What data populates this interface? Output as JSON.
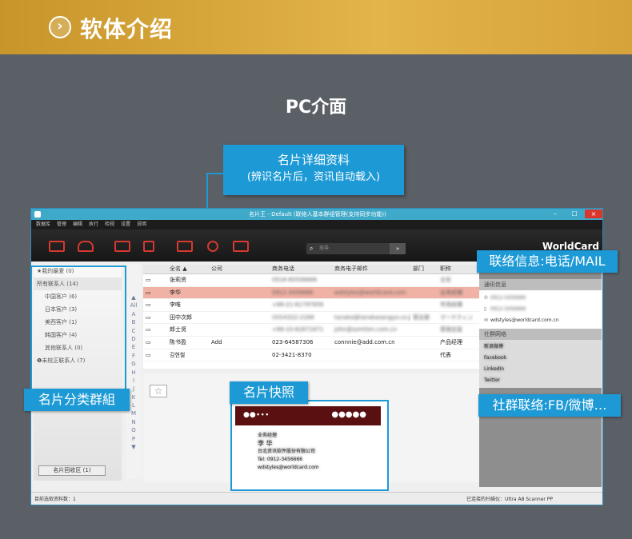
{
  "banner": {
    "icon": "chevron-right-icon",
    "title": "软体介绍"
  },
  "subtitle": "PC介面",
  "callouts": {
    "detail_line1": "名片详细资料",
    "detail_line2": "(辨识名片后，资讯自动载入)",
    "contact_info": "联络信息:电话/MAIL",
    "groups": "名片分类群組",
    "snapshot": "名片快照",
    "social": "社群联络:FB/微博…"
  },
  "window": {
    "title": "名片王 - Default (联络人基本群组管理(支持同步功能))",
    "menu": [
      "数据库",
      "管理",
      "编辑",
      "执行",
      "检视",
      "设置",
      "说明"
    ],
    "search_placeholder": "搜尋",
    "brand": "WorldCard",
    "controls": {
      "minimize": "–",
      "maximize": "☐",
      "close": "×"
    }
  },
  "sidebar": {
    "favorites": "★我的最爱 (0)",
    "all": "所有联系人 (14)",
    "groups": [
      "中国客户 (6)",
      "日本客户 (3)",
      "美西客户 (1)",
      "韩国客户 (4)",
      "其他联系人 (0)"
    ],
    "unconfirmed": "❶未校正联系人 (7)",
    "bin_button": "名片回收区 (1)"
  },
  "alpha_index": [
    "▲",
    "All",
    "A",
    "B",
    "C",
    "D",
    "E",
    "F",
    "G",
    "H",
    "I",
    "J",
    "K",
    "L",
    "M",
    "N",
    "O",
    "P",
    "▼"
  ],
  "grid": {
    "headers": [
      "",
      "全名 ▲",
      "公司",
      "商务电话",
      "商务电子邮件",
      "部门",
      "职称"
    ],
    "rows": [
      {
        "name": "张莉资",
        "company": "",
        "phone": "0516-85506688",
        "email": "",
        "dept": "",
        "title": "主任"
      },
      {
        "name": "李华",
        "company": "",
        "phone": "0912-3456666",
        "email": "wdstyles@worldcard.com",
        "dept": "",
        "title": "业务经理"
      },
      {
        "name": "李唯",
        "company": "",
        "phone": "+86-21-61797856",
        "email": "",
        "dept": "",
        "title": "市场经理"
      },
      {
        "name": "田中次郎",
        "company": "",
        "phone": "(03)4322-2168",
        "email": "tanaka@tanakasangyo.co.jp",
        "dept": "营业部",
        "title": "マーケティング"
      },
      {
        "name": "郎士贤",
        "company": "",
        "phone": "+86-10-62671671",
        "email": "john@somtien.com.cn",
        "dept": "",
        "title": "营销总监"
      },
      {
        "name": "陈书盈",
        "company": "Add",
        "phone": "023-64587306",
        "email": "connnie@add.com.cn",
        "dept": "",
        "title": "产品经理"
      },
      {
        "name": "김현철",
        "company": "",
        "phone": "02-3421-8370",
        "email": "",
        "dept": "",
        "title": "代表"
      }
    ]
  },
  "card": {
    "name_label": "业务经理",
    "name": "李 华",
    "company": "台北资讯软件股份有限公司",
    "tel": "Tel: 0912-3456666",
    "email": "wdstyles@worldcard.com"
  },
  "right_panel": {
    "contact_header": "通讯信息",
    "contact_items": [
      {
        "icon": "phone-icon",
        "text": "0912-3456666"
      },
      {
        "icon": "mobile-icon",
        "text": "0912-3456666"
      },
      {
        "icon": "mail-icon",
        "text": "wdstyles@worldcard.com.cn"
      }
    ],
    "social_header": "社群网络",
    "social_items": [
      "新浪微博",
      "Facebook",
      "LinkedIn",
      "Twitter"
    ]
  },
  "status": {
    "left": "目前选取资料数：1",
    "right": "已连接的扫描仪：Ultra A8 Scanner PP"
  },
  "colors": {
    "accent": "#1d9ad6",
    "banner": "#d9a43a",
    "selected_row": "#f0b2a4",
    "close": "#d9372c"
  }
}
